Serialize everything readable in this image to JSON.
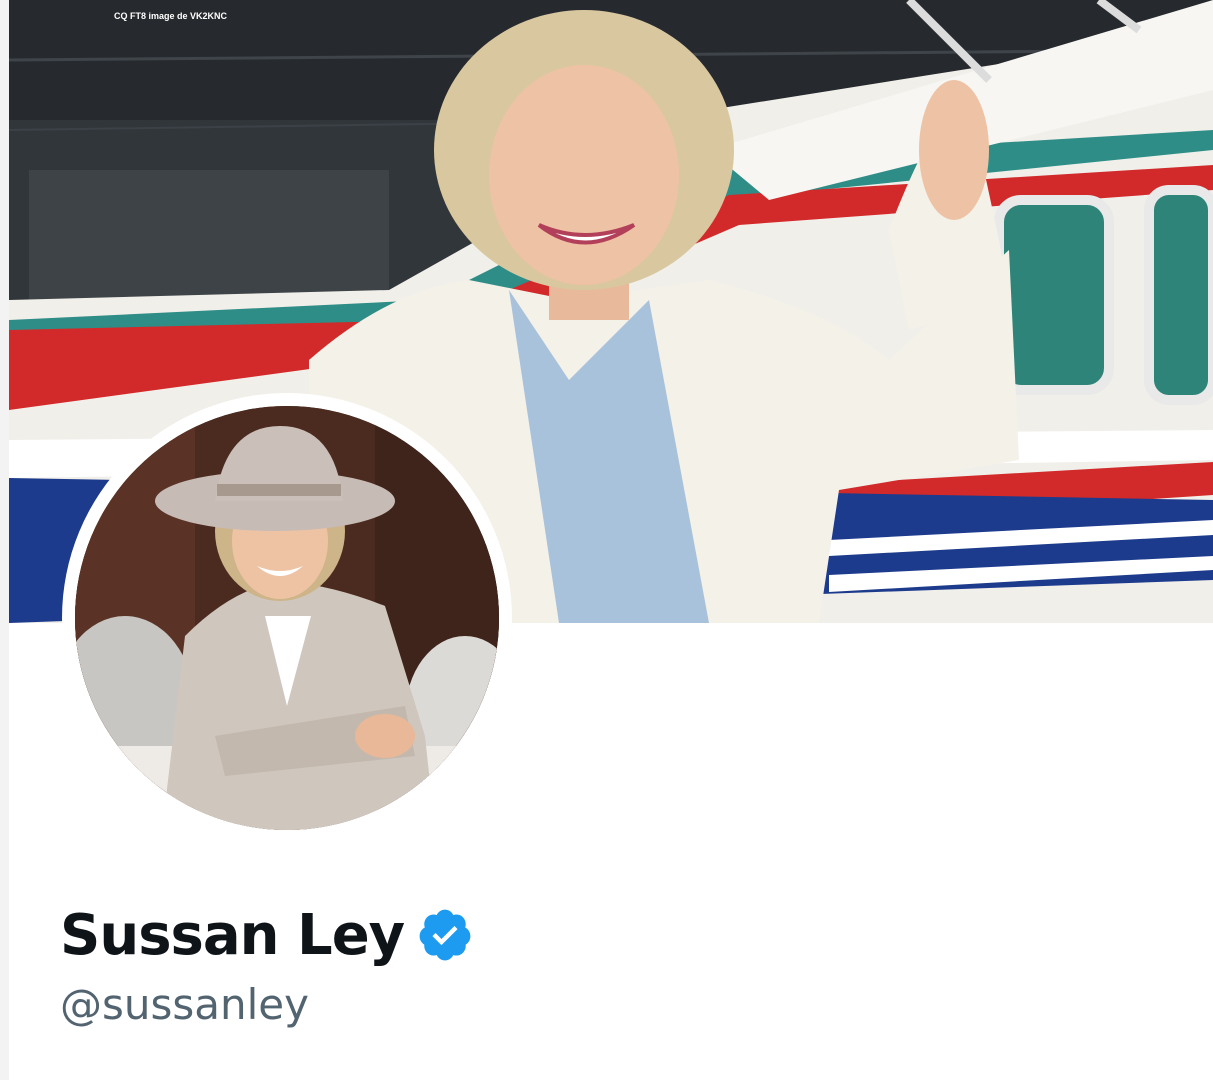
{
  "watermark": "CQ FT8 image de VK2KNC",
  "profile": {
    "display_name": "Sussan Ley",
    "handle": "@sussanley",
    "verified": true,
    "verified_icon": "verified-badge-icon",
    "verified_color": "#1d9bf0"
  },
  "banner": {
    "description_icon": "banner-photo",
    "accent_colors": [
      "#d52b2b",
      "#1f3f8f",
      "#f4f1ec",
      "#2e8a86"
    ]
  },
  "avatar": {
    "icon": "avatar-photo"
  }
}
